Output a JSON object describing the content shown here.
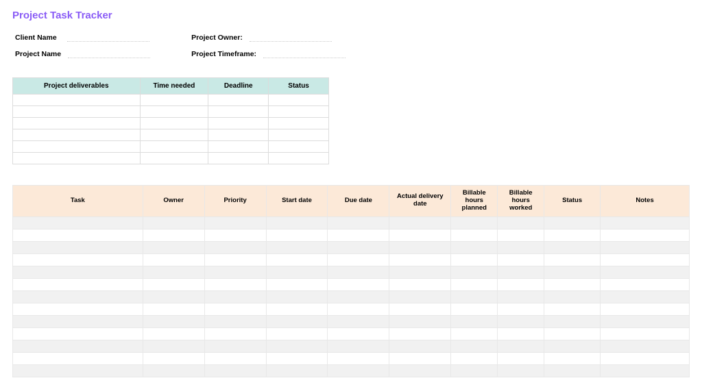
{
  "title": "Project Task Tracker",
  "meta": {
    "client_name_label": "Client Name",
    "client_name_value": "",
    "project_name_label": "Project Name",
    "project_name_value": "",
    "project_owner_label": "Project Owner:",
    "project_owner_value": "",
    "project_timeframe_label": "Project Timeframe:",
    "project_timeframe_value": ""
  },
  "deliverables_table": {
    "headers": {
      "col1": "Project deliverables",
      "col2": "Time needed",
      "col3": "Deadline",
      "col4": "Status"
    },
    "row_count": 6
  },
  "tasks_table": {
    "headers": {
      "task": "Task",
      "owner": "Owner",
      "priority": "Priority",
      "start_date": "Start date",
      "due_date": "Due date",
      "actual_delivery": "Actual delivery date",
      "billable_planned": "Billable hours planned",
      "billable_worked": "Billable hours worked",
      "status": "Status",
      "notes": "Notes"
    },
    "row_count": 13
  }
}
